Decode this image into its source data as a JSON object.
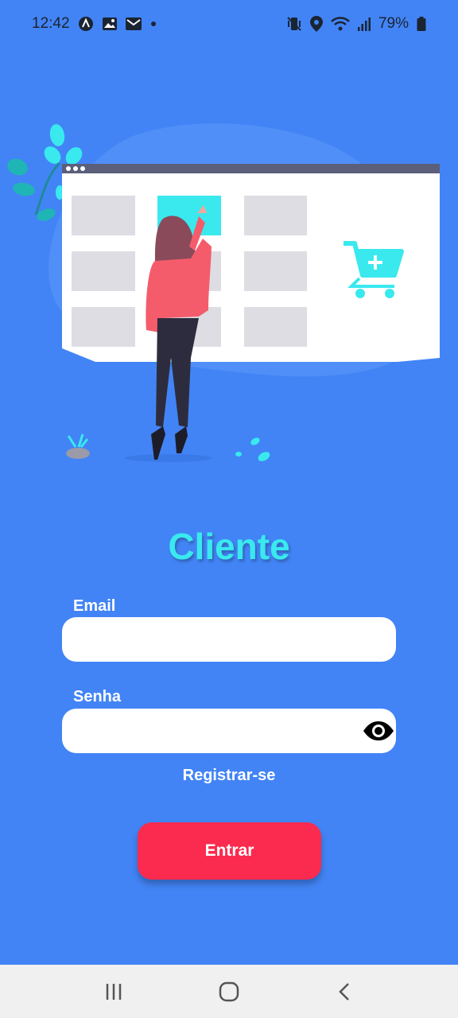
{
  "status_bar": {
    "time": "12:42",
    "battery_percent": "79%",
    "icons_left": [
      "app-notification-icon",
      "image-icon",
      "mail-icon",
      "dot-icon"
    ],
    "icons_right": [
      "mute-vibrate-icon",
      "location-icon",
      "wifi-icon",
      "signal-icon",
      "battery-icon"
    ]
  },
  "illustration": {
    "description_icon": "online-shopping-illustration",
    "colors": {
      "accent": "#39e9ee",
      "window": "#ffffff",
      "window_bar": "#5b5f7a",
      "tiles": "#dddde3",
      "jacket": "#f45c6c",
      "hair": "#8a4a5a"
    }
  },
  "form": {
    "title": "Cliente",
    "email_label": "Email",
    "email_value": "",
    "email_placeholder": "",
    "password_label": "Senha",
    "password_value": "",
    "password_placeholder": "",
    "register_link": "Registrar-se",
    "login_button": "Entrar"
  },
  "nav_bar": {
    "buttons": [
      "recent-apps-icon",
      "home-icon",
      "back-icon"
    ]
  },
  "colors": {
    "background": "#4284f5",
    "title": "#39e9ee",
    "button": "#fa2b4e",
    "nav_bar": "#f0f0f0"
  }
}
